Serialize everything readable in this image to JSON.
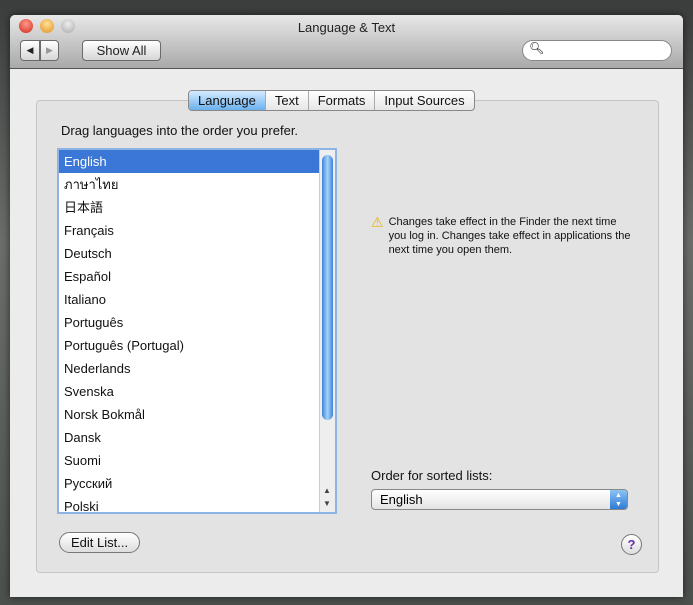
{
  "window": {
    "title": "Language & Text"
  },
  "toolbar": {
    "show_all": "Show All",
    "back": "◀",
    "forward": "▶",
    "search_placeholder": ""
  },
  "tabs": [
    {
      "label": "Language",
      "selected": true
    },
    {
      "label": "Text"
    },
    {
      "label": "Formats"
    },
    {
      "label": "Input Sources"
    }
  ],
  "language": {
    "instruction": "Drag languages into the order you prefer.",
    "languages": [
      "English",
      "ภาษาไทย",
      "日本語",
      "Français",
      "Deutsch",
      "Español",
      "Italiano",
      "Português",
      "Português (Portugal)",
      "Nederlands",
      "Svenska",
      "Norsk Bokmål",
      "Dansk",
      "Suomi",
      "Русский",
      "Polski"
    ],
    "selected": "English",
    "notice": "Changes take effect in the Finder the next time you log in. Changes take effect in applications the next time you open them.",
    "sort_label": "Order for sorted lists:",
    "sort_value": "English",
    "edit_list": "Edit List...",
    "help": "?"
  }
}
